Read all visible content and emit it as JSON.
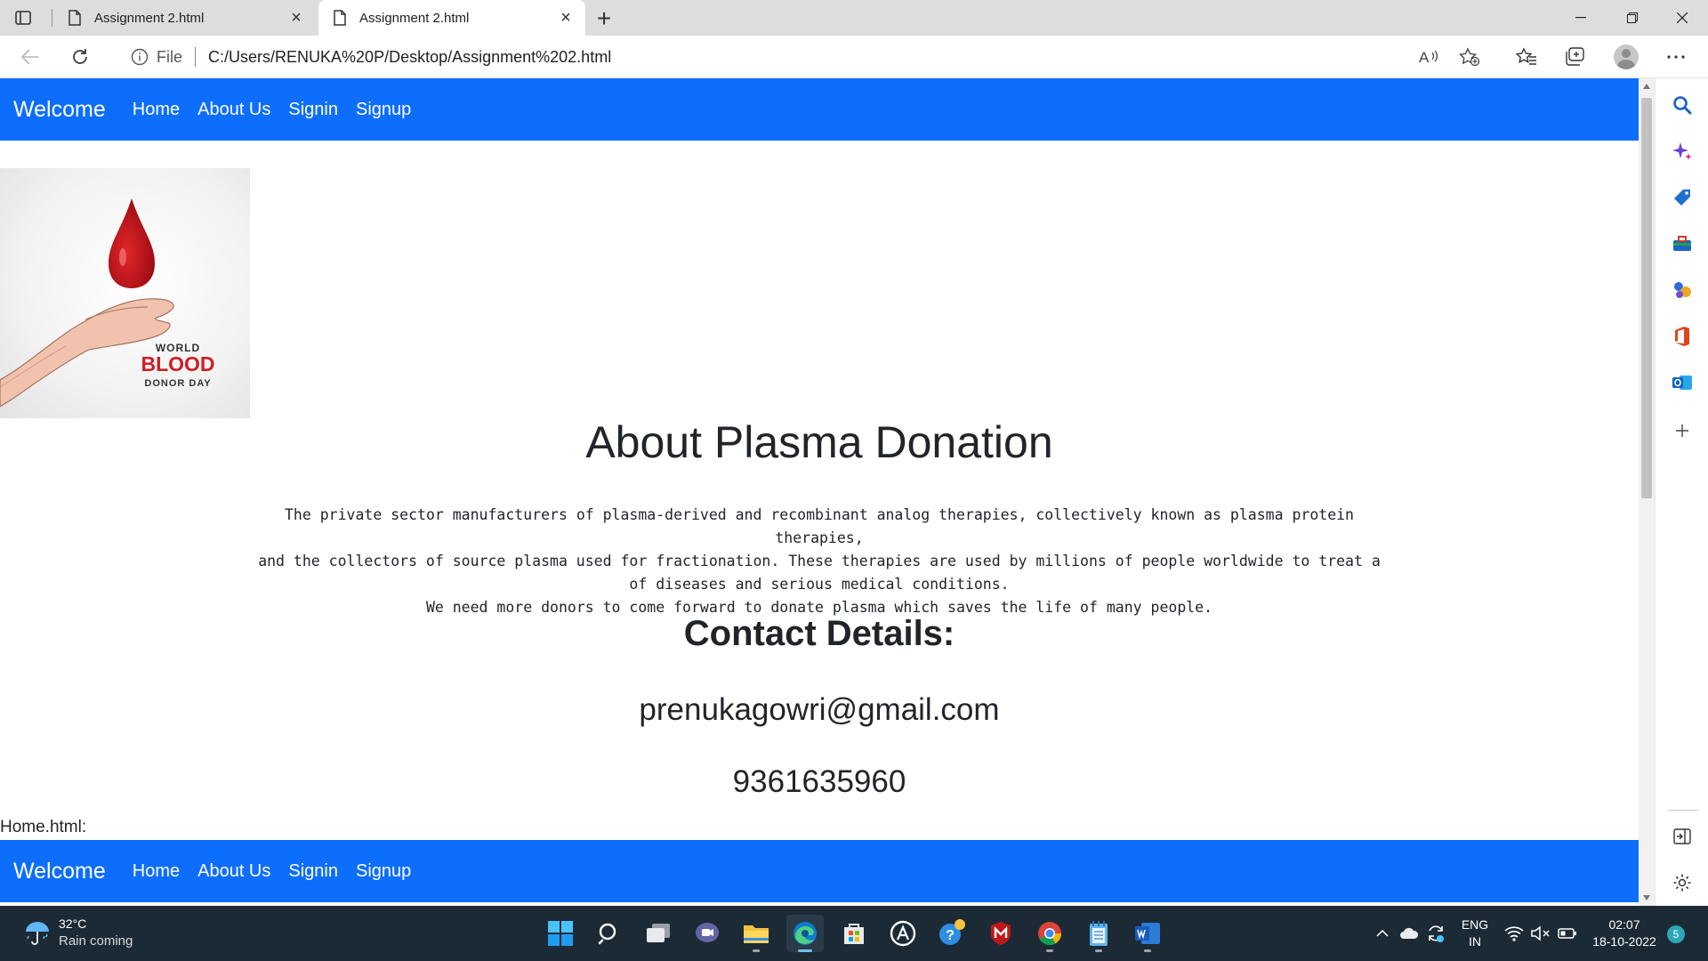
{
  "browser": {
    "tabs": [
      {
        "title": "Assignment 2.html"
      },
      {
        "title": "Assignment 2.html"
      }
    ],
    "address": {
      "scheme_label": "File",
      "url": "C:/Users/RENUKA%20P/Desktop/Assignment%202.html"
    }
  },
  "page": {
    "navbar": {
      "brand": "Welcome",
      "links": [
        "Home",
        "About Us",
        "Signin",
        "Signup"
      ]
    },
    "hero_image": {
      "line1": "WORLD",
      "line2": "BLOOD",
      "line3": "DONOR DAY"
    },
    "about": {
      "title": "About Plasma Donation",
      "paragraph_lines": [
        "The private sector manufacturers of plasma-derived and recombinant analog therapies, collectively known as plasma protein therapies,",
        "and the collectors of source plasma used for fractionation. These therapies are used by millions of people worldwide to treat a",
        "of diseases and serious medical conditions.",
        "We need more donors to come forward to donate plasma which saves the life of many people."
      ]
    },
    "contact": {
      "title": "Contact Details:",
      "email": "prenukagowri@gmail.com",
      "phone": "9361635960"
    },
    "file_label": "Home.html:",
    "navbar_bottom": {
      "brand": "Welcome",
      "links": [
        "Home",
        "About Us",
        "Signin",
        "Signup"
      ]
    }
  },
  "taskbar": {
    "weather": {
      "temp": "32°C",
      "desc": "Rain coming"
    },
    "language": {
      "line1": "ENG",
      "line2": "IN"
    },
    "clock": {
      "time": "02:07",
      "date": "18-10-2022"
    },
    "notifications": "5"
  },
  "colors": {
    "navbar": "#0d6efd",
    "taskbar": "#1c2a36",
    "text": "#212529"
  }
}
